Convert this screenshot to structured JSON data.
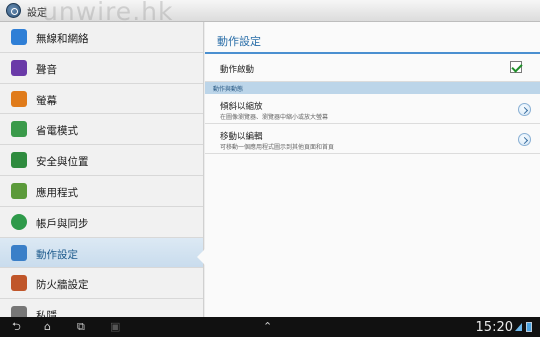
{
  "app": {
    "title": "設定",
    "watermark": "unwire.hk"
  },
  "sidebar": {
    "items": [
      {
        "label": "無線和網絡",
        "icon": "wifi-icon"
      },
      {
        "label": "聲音",
        "icon": "speaker-icon"
      },
      {
        "label": "螢幕",
        "icon": "display-icon"
      },
      {
        "label": "省電模式",
        "icon": "power-saving-icon"
      },
      {
        "label": "安全與位置",
        "icon": "security-grid-icon"
      },
      {
        "label": "應用程式",
        "icon": "applications-icon"
      },
      {
        "label": "帳戶與同步",
        "icon": "sync-icon"
      },
      {
        "label": "動作設定",
        "icon": "motion-icon",
        "selected": true
      },
      {
        "label": "防火牆設定",
        "icon": "firewall-icon"
      },
      {
        "label": "私隱",
        "icon": "privacy-icon"
      }
    ]
  },
  "main": {
    "title": "動作設定",
    "motion_toggle": {
      "label": "動作啟動",
      "checked": true
    },
    "section_header": "動作與動態",
    "items": [
      {
        "label": "傾斜以縮放",
        "sub": "在圖像瀏覽器、瀏覽器中縮小或放大螢幕"
      },
      {
        "label": "移動以編輯",
        "sub": "可移動一個應用程式圖示到其他頁面和首頁"
      }
    ]
  },
  "navbar": {
    "clock": "15:20",
    "buttons": [
      "back-icon",
      "home-icon",
      "recent-apps-icon",
      "screenshot-icon",
      "expand-up-icon"
    ]
  },
  "colors": {
    "accent": "#2a6ea8",
    "section": "#bcd5e9",
    "selected": "#c9dced",
    "check": "#1f8f2a"
  }
}
